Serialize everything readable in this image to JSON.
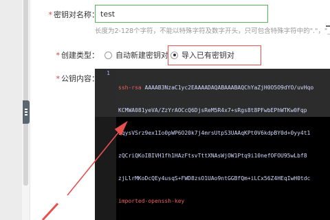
{
  "form": {
    "key_name": {
      "label": "密钥对名称：",
      "value": "test",
      "hint": "长度为2-128个字符，不能以特殊字符及数字开头，只可包含特殊字符中的\".\"，\"_\""
    },
    "create_type": {
      "label": "创建类型：",
      "options": [
        {
          "label": "自动新建密钥对",
          "checked": false
        },
        {
          "label": "导入已有密钥对",
          "checked": true
        }
      ]
    },
    "public_key": {
      "label": "公钥内容：",
      "line_number": "1",
      "lines": [
        {
          "prefix": "ssh-rsa",
          "text": " AAAAB3NzaC1yc2EAAAADAQABAAABAQChYaZjH0O5O9dYO/uvHqo"
        },
        {
          "prefix": "",
          "text": "KCMWA081yeVA/ZzYrAOCcQ6DjsReM5R4x7+sRgs8t8PFwbEPhWTKw0Fqp"
        },
        {
          "prefix": "",
          "text": "sqysVSrz9ex1Io0pWP6O20k7j4mrsUtpS3UAAqKPt0V6kdpBY0d+0yy4t1"
        },
        {
          "prefix": "",
          "text": "zQCriQKoIBIVH1fh1HAzFtsvTttXNAsWjOW1Ptq9i10nefOFOU95wLbf8"
        },
        {
          "prefix": "",
          "text": "zjLlrMKoDcQEy4usqS+FWD8zsO1UAo9ntGGBfQm+iLCx56Z4HEqIwH0tdc"
        },
        {
          "prefix": "",
          "text": "imported-openssh-key"
        }
      ]
    }
  },
  "colors": {
    "required": "#e4393c",
    "input_focus_border": "#55b55a",
    "annotation_red": "#e85050"
  },
  "icons": [
    "grip-icon",
    "arrow-annotation"
  ]
}
